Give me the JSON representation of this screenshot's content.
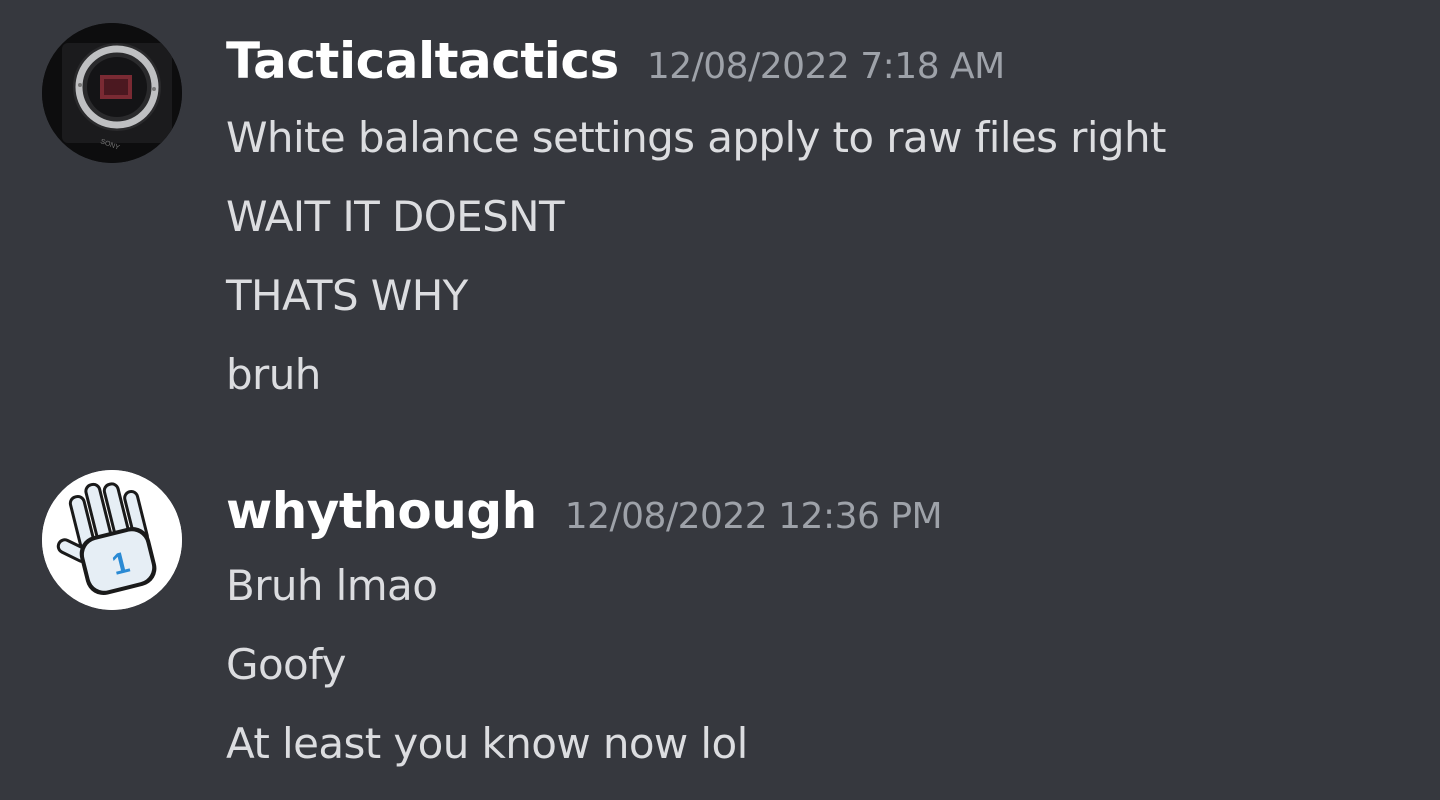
{
  "messages": [
    {
      "username": "Tacticaltactics",
      "timestamp": "12/08/2022 7:18 AM",
      "avatar": "camera-sensor-avatar",
      "lines": [
        "White balance settings apply to raw files right",
        "WAIT IT DOESNT",
        "THATS WHY",
        "bruh"
      ]
    },
    {
      "username": "whythough",
      "timestamp": "12/08/2022 12:36 PM",
      "avatar": "glove-hand-avatar",
      "lines": [
        "Bruh lmao",
        "Goofy",
        "At least you know now lol"
      ]
    }
  ],
  "colors": {
    "background": "#36383e",
    "username": "#ffffff",
    "timestamp": "#9ea2a9",
    "message_text": "#dcdde0",
    "accent_blue": "#2a8ad4"
  }
}
